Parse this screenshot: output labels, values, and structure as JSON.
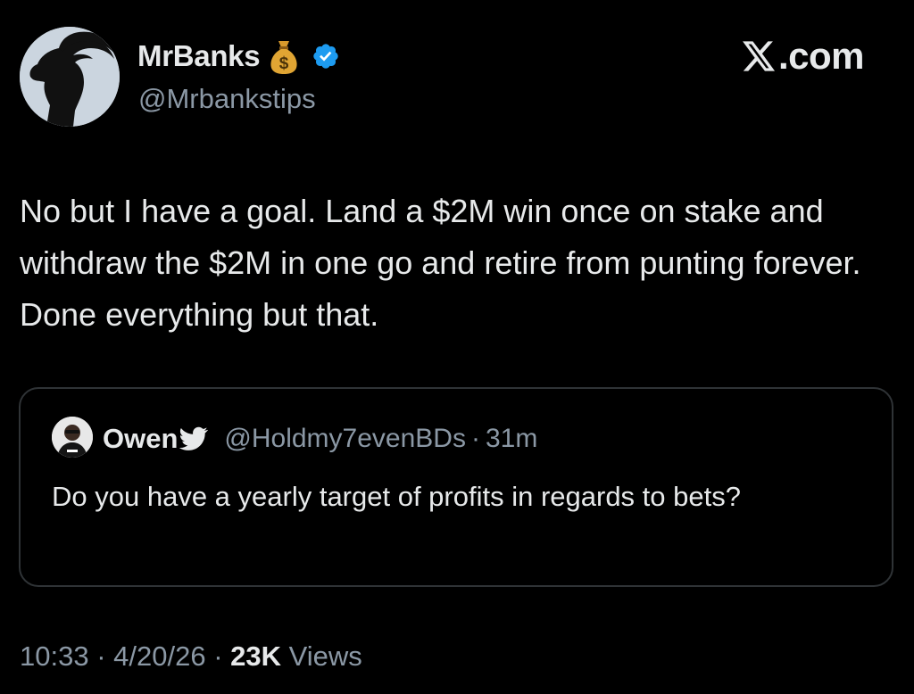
{
  "author": {
    "display_name": "MrBanks",
    "handle": "@Mrbankstips",
    "emoji_icon": "money-bag-icon",
    "verified": true,
    "verified_color": "#1d9bf0"
  },
  "watermark": {
    "text": ".com",
    "icon": "x-logo-icon"
  },
  "tweet": {
    "text": "No but I have a goal. Land a $2M win once on stake and withdraw the $2M in one go and retire from punting forever. Done everything but that."
  },
  "quoted_tweet": {
    "display_name": "Owen",
    "badge_icon": "bird-icon",
    "handle": "@Holdmy7evenBDs",
    "separator": "·",
    "time_ago": "31m",
    "text": "Do you have a yearly target of profits in regards to bets?"
  },
  "meta": {
    "time": "10:33",
    "separator": "·",
    "date": "4/20/26",
    "views_count": "23K",
    "views_label": "Views"
  },
  "colors": {
    "background": "#000000",
    "text_primary": "#e7e9ea",
    "text_secondary": "#8b98a5",
    "border": "#2f3336"
  }
}
